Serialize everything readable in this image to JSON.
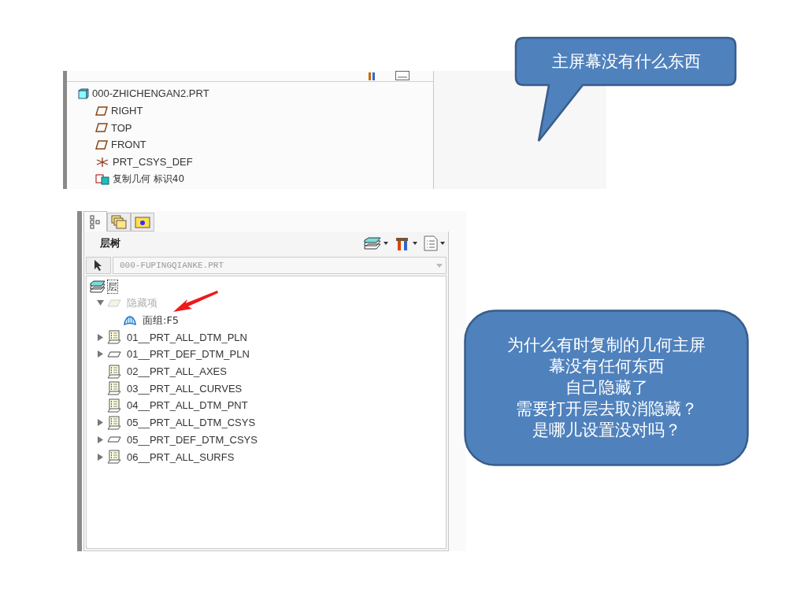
{
  "model_tree": {
    "items": [
      {
        "label": "000-ZHICHENGAN2.PRT",
        "kind": "part"
      },
      {
        "label": "RIGHT",
        "kind": "plane"
      },
      {
        "label": "TOP",
        "kind": "plane"
      },
      {
        "label": "FRONT",
        "kind": "plane"
      },
      {
        "label": "PRT_CSYS_DEF",
        "kind": "csys"
      },
      {
        "label": "复制几何 标识40",
        "kind": "copy_geom"
      }
    ]
  },
  "layer_tree": {
    "tabs": [
      {
        "kind": "tree",
        "selected": true
      },
      {
        "kind": "folders",
        "selected": false
      },
      {
        "kind": "favorites",
        "selected": false
      }
    ],
    "title": "层树",
    "model_field": {
      "value": "000-FUPINGQIANKE.PRT"
    },
    "root_label": "层",
    "items": [
      {
        "label": "隐藏项",
        "kind": "hidden",
        "expandable": true,
        "expanded": true,
        "children": [
          {
            "label": "面组:F5",
            "kind": "quilt"
          }
        ]
      },
      {
        "label": "01__PRT_ALL_DTM_PLN",
        "kind": "layer",
        "expandable": true,
        "expanded": false
      },
      {
        "label": "01__PRT_DEF_DTM_PLN",
        "kind": "default",
        "expandable": true,
        "expanded": false
      },
      {
        "label": "02__PRT_ALL_AXES",
        "kind": "layer",
        "expandable": false
      },
      {
        "label": "03__PRT_ALL_CURVES",
        "kind": "layer",
        "expandable": false
      },
      {
        "label": "04__PRT_ALL_DTM_PNT",
        "kind": "layer",
        "expandable": false
      },
      {
        "label": "05__PRT_ALL_DTM_CSYS",
        "kind": "layer",
        "expandable": true,
        "expanded": false
      },
      {
        "label": "05__PRT_DEF_DTM_CSYS",
        "kind": "default",
        "expandable": true,
        "expanded": false
      },
      {
        "label": "06__PRT_ALL_SURFS",
        "kind": "layer",
        "expandable": true,
        "expanded": false
      }
    ]
  },
  "callouts": [
    {
      "kind": "tail",
      "lines": [
        "主屏幕没有什么东西"
      ]
    },
    {
      "kind": "rounded",
      "lines": [
        "为什么有时复制的几何主屏",
        "幕没有任何东西",
        "自己隐藏了",
        "需要打开层去取消隐藏？",
        "是哪儿设置没对吗？"
      ]
    }
  ]
}
